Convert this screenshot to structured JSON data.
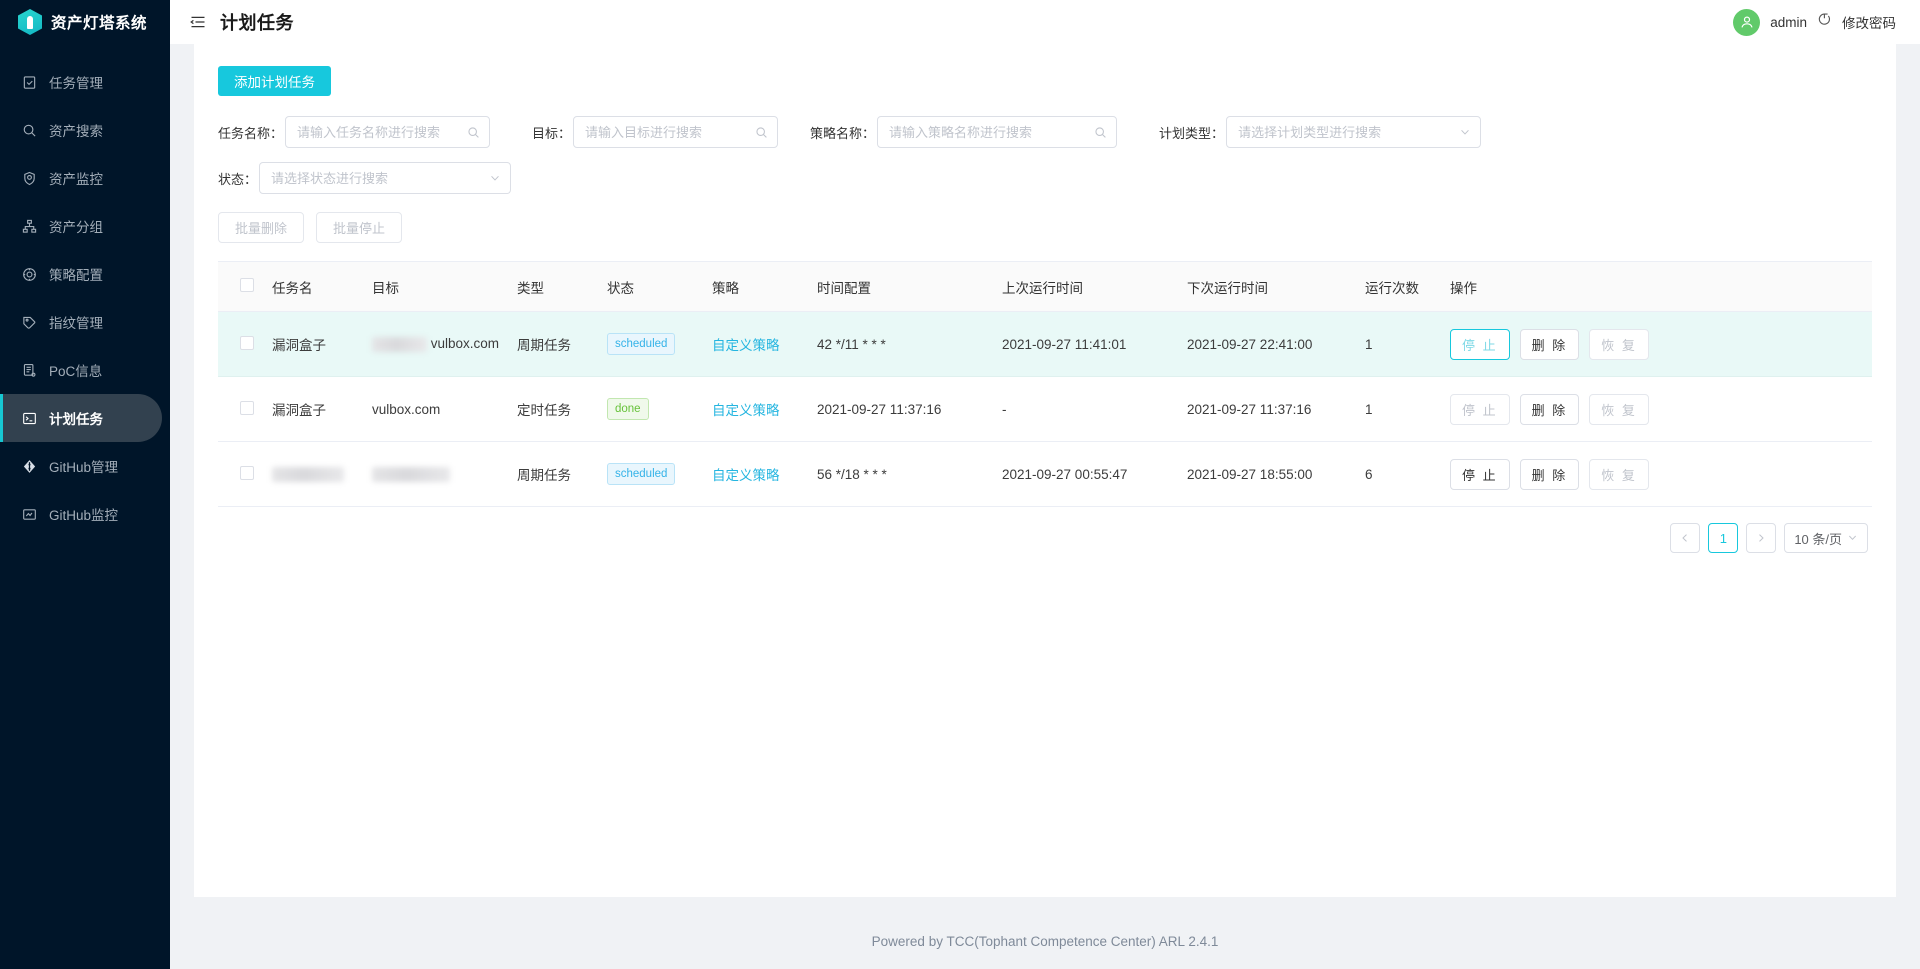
{
  "brand": {
    "title": "资产灯塔系统",
    "logo_icon": "hexagon-lighthouse-icon"
  },
  "sidebar": {
    "items": [
      {
        "label": "任务管理",
        "icon": "clipboard-check-icon",
        "active": false
      },
      {
        "label": "资产搜索",
        "icon": "search-icon",
        "active": false
      },
      {
        "label": "资产监控",
        "icon": "shield-monitor-icon",
        "active": false
      },
      {
        "label": "资产分组",
        "icon": "sitemap-icon",
        "active": false
      },
      {
        "label": "策略配置",
        "icon": "badge-gear-icon",
        "active": false
      },
      {
        "label": "指纹管理",
        "icon": "tag-fingerprint-icon",
        "active": false
      },
      {
        "label": "PoC信息",
        "icon": "document-list-icon",
        "active": false
      },
      {
        "label": "计划任务",
        "icon": "terminal-icon",
        "active": true
      },
      {
        "label": "GitHub管理",
        "icon": "github-branch-icon",
        "active": false
      },
      {
        "label": "GitHub监控",
        "icon": "github-monitor-icon",
        "active": false
      }
    ]
  },
  "topbar": {
    "collapse_icon": "menu-fold-icon",
    "page_title": "计划任务",
    "avatar_icon": "user-avatar-icon",
    "username": "admin",
    "logout_icon": "power-logout-icon",
    "change_password": "修改密码"
  },
  "toolbar": {
    "add_label": "添加计划任务"
  },
  "filters": {
    "task_name": {
      "label": "任务名称：",
      "placeholder": "请输入任务名称进行搜索",
      "value": "",
      "icon": "search-icon"
    },
    "target": {
      "label": "目标：",
      "placeholder": "请输入目标进行搜索",
      "value": "",
      "icon": "search-icon"
    },
    "policy_name": {
      "label": "策略名称：",
      "placeholder": "请输入策略名称进行搜索",
      "value": "",
      "icon": "search-icon"
    },
    "plan_type": {
      "label": "计划类型：",
      "placeholder": "请选择计划类型进行搜索",
      "value": "",
      "icon": "chevron-down-icon"
    },
    "status": {
      "label": "状态：",
      "placeholder": "请选择状态进行搜索",
      "value": "",
      "icon": "chevron-down-icon"
    }
  },
  "bulk": {
    "delete_label": "批量删除",
    "stop_label": "批量停止"
  },
  "table": {
    "columns": [
      "",
      "任务名",
      "目标",
      "类型",
      "状态",
      "策略",
      "时间配置",
      "上次运行时间",
      "下次运行时间",
      "运行次数",
      "操作"
    ],
    "rows": [
      {
        "highlighted": true,
        "name": "漏洞盒子",
        "name_blurred": false,
        "target": "vulbox.com",
        "target_blurred_prefix": true,
        "type": "周期任务",
        "status": "scheduled",
        "status_kind": "scheduled",
        "policy": "自定义策略",
        "time_config": "42 */11 * * *",
        "last_run": "2021-09-27 11:41:01",
        "next_run": "2021-09-27 22:41:00",
        "run_count": "1",
        "ops": {
          "stop": "停 止",
          "delete": "删 除",
          "resume": "恢 复"
        },
        "stop_enabled": true,
        "stop_focused": true,
        "delete_enabled": true,
        "resume_enabled": false
      },
      {
        "highlighted": false,
        "name": "漏洞盒子",
        "name_blurred": false,
        "target": "vulbox.com",
        "target_blurred_prefix": false,
        "type": "定时任务",
        "status": "done",
        "status_kind": "done",
        "policy": "自定义策略",
        "time_config": "2021-09-27 11:37:16",
        "last_run": "-",
        "next_run": "2021-09-27 11:37:16",
        "run_count": "1",
        "ops": {
          "stop": "停 止",
          "delete": "删 除",
          "resume": "恢 复"
        },
        "stop_enabled": false,
        "stop_focused": false,
        "delete_enabled": true,
        "resume_enabled": false
      },
      {
        "highlighted": false,
        "name": "",
        "name_blurred": true,
        "target": "",
        "target_blurred_prefix": false,
        "target_blurred": true,
        "type": "周期任务",
        "status": "scheduled",
        "status_kind": "scheduled",
        "policy": "自定义策略",
        "time_config": "56 */18 * * *",
        "last_run": "2021-09-27 00:55:47",
        "next_run": "2021-09-27 18:55:00",
        "run_count": "6",
        "ops": {
          "stop": "停 止",
          "delete": "删 除",
          "resume": "恢 复"
        },
        "stop_enabled": true,
        "stop_focused": false,
        "delete_enabled": true,
        "resume_enabled": false
      }
    ]
  },
  "pagination": {
    "prev_icon": "chevron-left-icon",
    "next_icon": "chevron-right-icon",
    "current_page": "1",
    "page_size": "10 条/页",
    "size_icon": "chevron-down-icon"
  },
  "footer": {
    "text": "Powered by TCC(Tophant Competence Center) ARL 2.4.1"
  },
  "colors": {
    "accent": "#17c8dd",
    "sidebar_bg": "#001529",
    "sidebar_active_bg": "#32414f",
    "row_highlight": "#e9f9f7",
    "link": "#24b5e0",
    "tag_scheduled": "#35b3e8",
    "tag_done": "#67c23a",
    "avatar_bg": "#61ca6a"
  }
}
